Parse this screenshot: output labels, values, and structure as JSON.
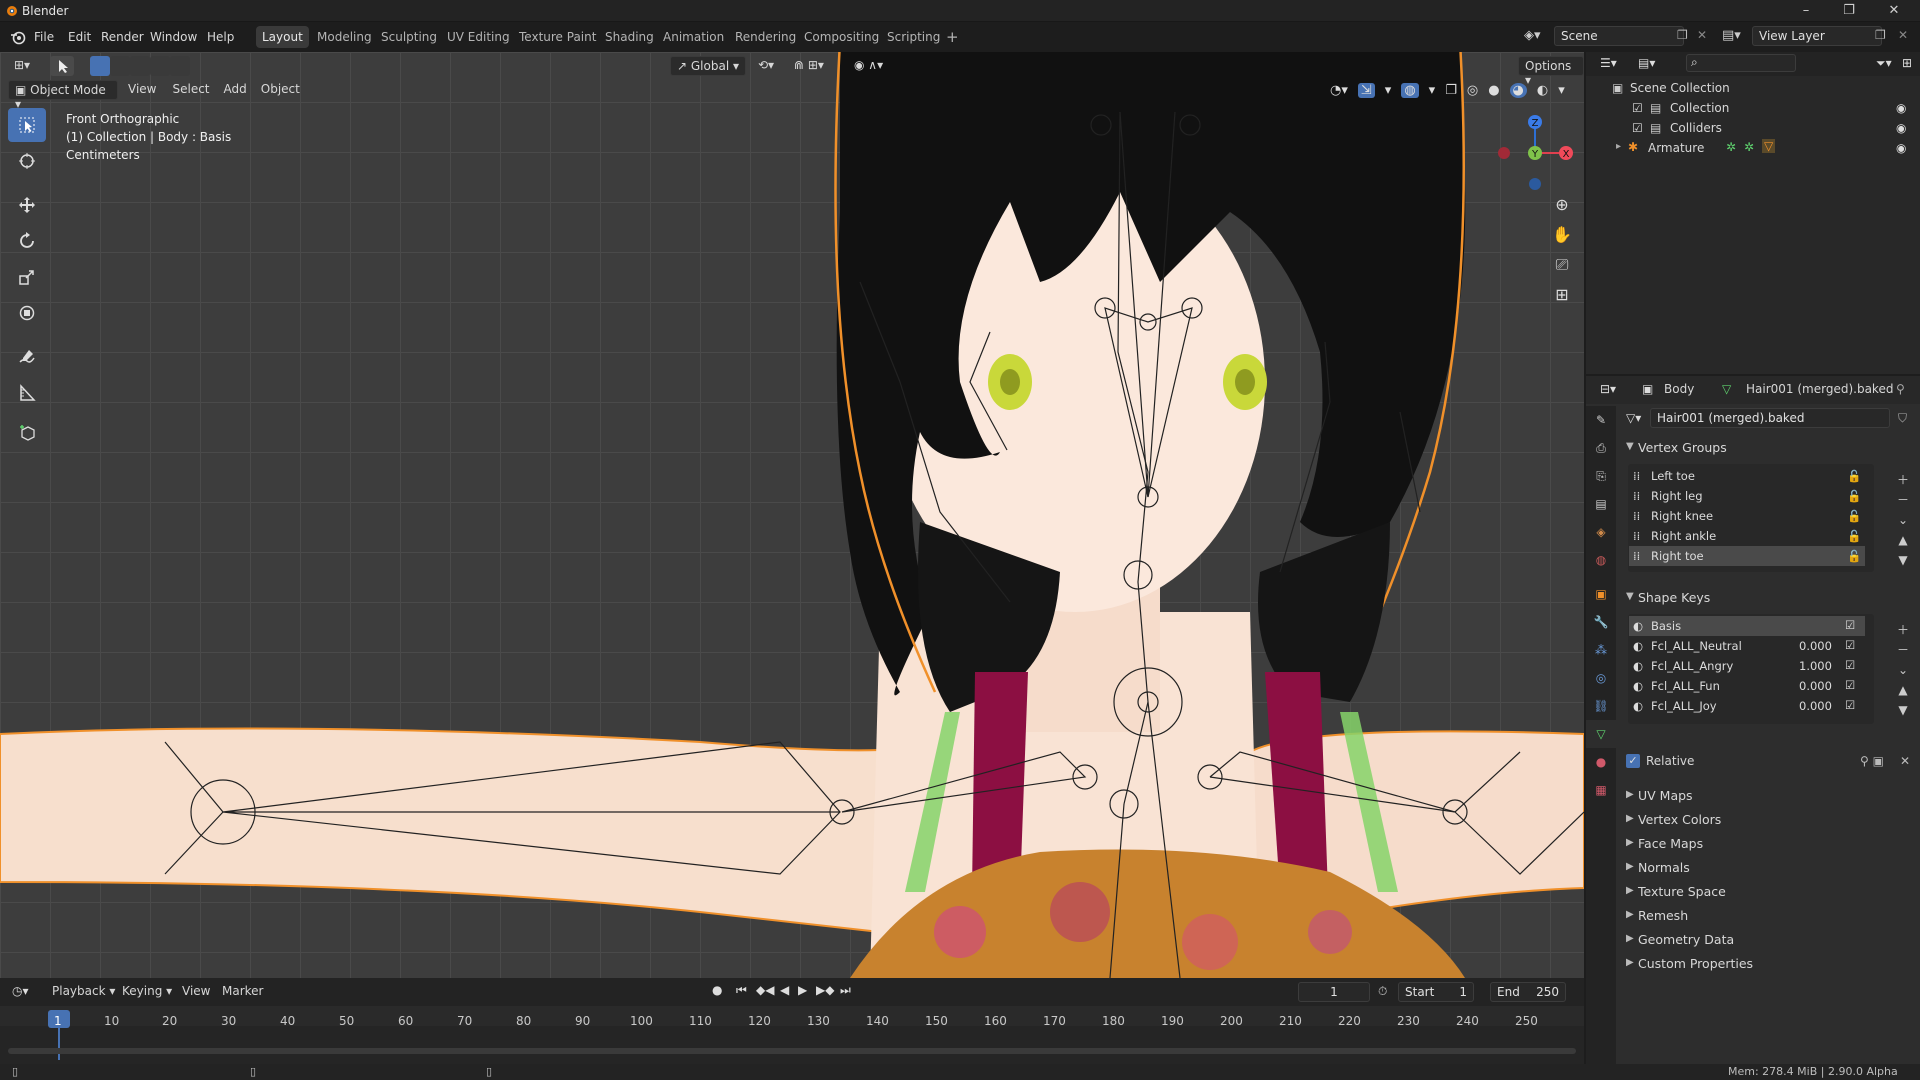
{
  "app_title": "Blender",
  "window_controls": {
    "minimize": "–",
    "maximize": "❐",
    "close": "✕"
  },
  "menu": [
    "File",
    "Edit",
    "Render",
    "Window",
    "Help"
  ],
  "workspaces": [
    {
      "label": "Layout",
      "active": true
    },
    {
      "label": "Modeling",
      "active": false
    },
    {
      "label": "Sculpting",
      "active": false
    },
    {
      "label": "UV Editing",
      "active": false
    },
    {
      "label": "Texture Paint",
      "active": false
    },
    {
      "label": "Shading",
      "active": false
    },
    {
      "label": "Animation",
      "active": false
    },
    {
      "label": "Rendering",
      "active": false
    },
    {
      "label": "Compositing",
      "active": false
    },
    {
      "label": "Scripting",
      "active": false
    }
  ],
  "add_workspace": "+",
  "scene_field": "Scene",
  "view_layer_field": "View Layer",
  "viewport": {
    "mode": "Object Mode",
    "menus": [
      "View",
      "Select",
      "Add",
      "Object"
    ],
    "transform_orientation": "Global",
    "options_label": "Options",
    "overlay_info": [
      "Front Orthographic",
      "(1) Collection | Body : Basis",
      "Centimeters"
    ],
    "gizmo_axes": {
      "z": "Z",
      "y": "Y",
      "x": "X"
    }
  },
  "outliner": {
    "search_placeholder": "",
    "items": [
      {
        "label": "Scene Collection"
      },
      {
        "label": "Collection"
      },
      {
        "label": "Colliders"
      },
      {
        "label": "Armature"
      }
    ]
  },
  "properties": {
    "object_name": "Body",
    "data_name": "Hair001 (merged).baked",
    "datablock_field": "Hair001 (merged).baked",
    "vertex_groups_title": "Vertex Groups",
    "vertex_groups": [
      "Left toe",
      "Right leg",
      "Right knee",
      "Right ankle",
      "Right toe"
    ],
    "selected_vertex_group": "Right toe",
    "shape_keys_title": "Shape Keys",
    "shape_keys": [
      {
        "name": "Basis",
        "value": ""
      },
      {
        "name": "Fcl_ALL_Neutral",
        "value": "0.000"
      },
      {
        "name": "Fcl_ALL_Angry",
        "value": "1.000"
      },
      {
        "name": "Fcl_ALL_Fun",
        "value": "0.000"
      },
      {
        "name": "Fcl_ALL_Joy",
        "value": "0.000"
      }
    ],
    "relative_label": "Relative",
    "collapsed_sections": [
      "UV Maps",
      "Vertex Colors",
      "Face Maps",
      "Normals",
      "Texture Space",
      "Remesh",
      "Geometry Data",
      "Custom Properties"
    ]
  },
  "timeline": {
    "menus": [
      "Playback",
      "Keying",
      "View",
      "Marker"
    ],
    "current_frame": "1",
    "start_label": "Start",
    "start_value": "1",
    "end_label": "End",
    "end_value": "250",
    "ticks": [
      "1",
      "10",
      "20",
      "30",
      "40",
      "50",
      "60",
      "70",
      "80",
      "90",
      "100",
      "110",
      "120",
      "130",
      "140",
      "150",
      "160",
      "170",
      "180",
      "190",
      "200",
      "210",
      "220",
      "230",
      "240",
      "250"
    ]
  },
  "status": "Mem: 278.4 MiB | 2.90.0 Alpha",
  "colors": {
    "accent": "#4772b3",
    "selection_outline": "#f0902a",
    "strap": "#8c0f42",
    "strap_green": "#86d46a"
  }
}
